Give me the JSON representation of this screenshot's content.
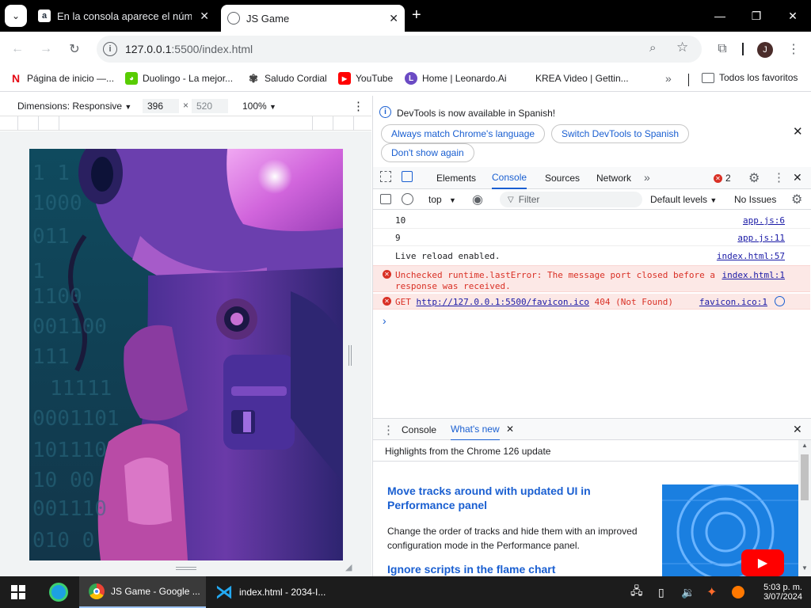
{
  "tabs": [
    {
      "label": "En la consola aparece el númer",
      "favicon": "a",
      "favicon_color": "#232f3e"
    },
    {
      "label": "JS Game",
      "favicon_color": "#dadce0"
    }
  ],
  "toolbar": {
    "url_host": "127.0.0.1",
    "url_path": ":5500/index.html",
    "profile_initial": "J"
  },
  "bookmarks": [
    {
      "label": "Página de inicio —...",
      "icon": "N",
      "icon_color": "#e50914"
    },
    {
      "label": "Duolingo - La mejor...",
      "icon": "D",
      "icon_color": "#58cc02"
    },
    {
      "label": "Saludo Cordial",
      "icon": "openai-icon",
      "icon_color": "#444"
    },
    {
      "label": "YouTube",
      "icon": "youtube-icon",
      "icon_color": "#ff0000"
    },
    {
      "label": "Home | Leonardo.Ai",
      "icon": "L",
      "icon_color": "#6b4bc4"
    },
    {
      "label": "KREA Video | Gettin...",
      "icon": "K",
      "icon_color": "#fff"
    },
    {
      "label": "Todos los favoritos",
      "icon": "folder-icon",
      "icon_color": "#5f6368"
    }
  ],
  "device_toolbar": {
    "dimensions_label": "Dimensions: Responsive",
    "width": "396",
    "times": "×",
    "height": "520",
    "zoom": "100%"
  },
  "game": {
    "binary_rows": [
      "1   1",
      "1000",
      "011",
      "1",
      "1100",
      "001100",
      "111",
      "11111",
      "0001101",
      "101110",
      "10 00",
      "001110",
      "010 0"
    ]
  },
  "devtools": {
    "banner_text": "DevTools is now available in Spanish!",
    "btn_match": "Always match Chrome's language",
    "btn_switch": "Switch DevTools to Spanish",
    "btn_dont_show": "Don't show again",
    "tabs": [
      "Elements",
      "Console",
      "Sources",
      "Network"
    ],
    "error_count": "2",
    "context": "top",
    "filter_placeholder": "Filter",
    "levels": "Default levels",
    "issues": "No Issues",
    "console_lines": [
      {
        "text": "10",
        "source": "app.js:6",
        "type": "log"
      },
      {
        "text": "9",
        "source": "app.js:11",
        "type": "log"
      },
      {
        "text": "Live reload enabled.",
        "source": "index.html:57",
        "type": "log"
      },
      {
        "text": "Unchecked runtime.lastError: The message port closed before a",
        "text2": "response was received.",
        "source": "index.html:1",
        "type": "error"
      },
      {
        "prefix": "GET",
        "link": "http://127.0.0.1:5500/favicon.ico",
        "suffix": "404 (Not Found)",
        "source": "favicon.ico:1",
        "type": "error"
      }
    ],
    "prompt": "›",
    "drawer_tabs": [
      "Console",
      "What's new"
    ],
    "whatsnew_header": "Highlights from the Chrome 126 update",
    "article1_title": "Move tracks around with updated UI in Performance panel",
    "article1_body": "Change the order of tracks and hide them with an improved configuration mode in the Performance panel.",
    "article2_title": "Ignore scripts in the flame chart"
  },
  "taskbar": {
    "chrome_label": "JS Game - Google ...",
    "vscode_label": "index.html - 2034-I...",
    "time": "5:03 p. m.",
    "date": "3/07/2024"
  },
  "colors": {
    "accent": "#1a5fd1",
    "error": "#d93025",
    "error_bg": "#fce8e6"
  }
}
